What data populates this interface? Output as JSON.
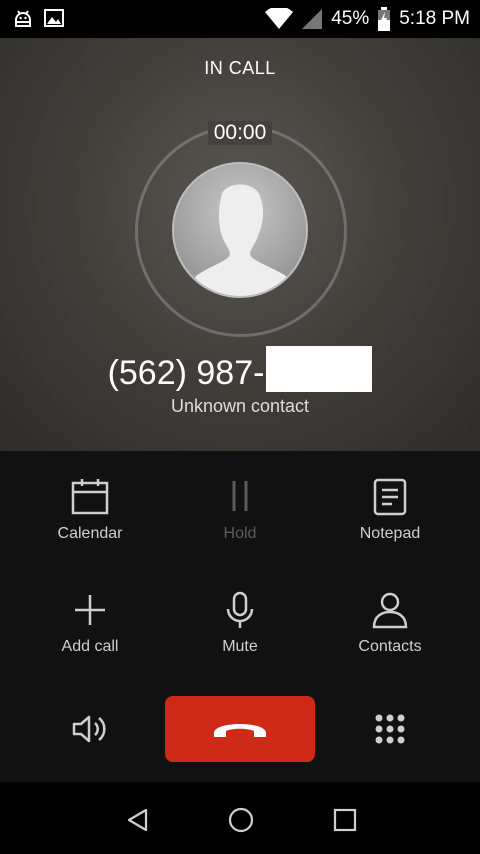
{
  "status_bar": {
    "battery": "45%",
    "time": "5:18 PM",
    "left_icons": [
      "android-debug-icon",
      "image-notification-icon"
    ],
    "right_icons": [
      "wifi-icon",
      "cellular-signal-icon",
      "battery-charging-icon"
    ]
  },
  "call": {
    "state": "IN CALL",
    "timer": "00:00",
    "number": "(562) 987-",
    "contact_label": "Unknown contact"
  },
  "controls": {
    "calendar": "Calendar",
    "hold": "Hold",
    "notepad": "Notepad",
    "add_call": "Add call",
    "mute": "Mute",
    "contacts": "Contacts"
  },
  "colors": {
    "end_call": "#cf2a17",
    "background": "#111111",
    "disabled_text": "#5d5d5d"
  }
}
